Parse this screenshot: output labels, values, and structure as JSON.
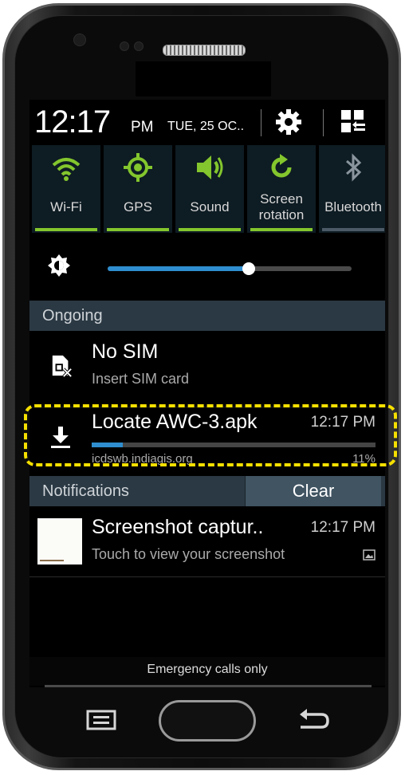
{
  "status_bar": {
    "time": "12:17",
    "ampm": "PM",
    "date": "TUE, 25 OC.."
  },
  "quick_settings": [
    {
      "label": "Wi-Fi",
      "icon": "wifi-icon",
      "on": true
    },
    {
      "label": "GPS",
      "icon": "gps-icon",
      "on": true
    },
    {
      "label": "Sound",
      "icon": "sound-icon",
      "on": true
    },
    {
      "label_line1": "Screen",
      "label_line2": "rotation",
      "icon": "rotation-icon",
      "on": true
    },
    {
      "label": "Bluetooth",
      "icon": "bluetooth-icon",
      "on": false
    }
  ],
  "brightness": {
    "level": 0.58
  },
  "ongoing": {
    "header": "Ongoing",
    "items": [
      {
        "title": "No SIM",
        "subtitle": "Insert SIM card",
        "icon": "sim-error-icon"
      },
      {
        "title": "Locate AWC-3.apk",
        "time": "12:17 PM",
        "source": "icdswb.indiagis.org",
        "progress_text": "11%",
        "progress": 0.11,
        "icon": "download-icon"
      }
    ]
  },
  "notifications": {
    "header": "Notifications",
    "clear_label": "Clear",
    "items": [
      {
        "title": "Screenshot captur..",
        "time": "12:17 PM",
        "subtitle": "Touch to view your screenshot",
        "icon": "image-icon"
      }
    ]
  },
  "emergency_text": "Emergency calls only",
  "colors": {
    "accent_green": "#83c62d",
    "accent_blue": "#2f8ecf",
    "highlight_yellow": "#f5e000"
  }
}
